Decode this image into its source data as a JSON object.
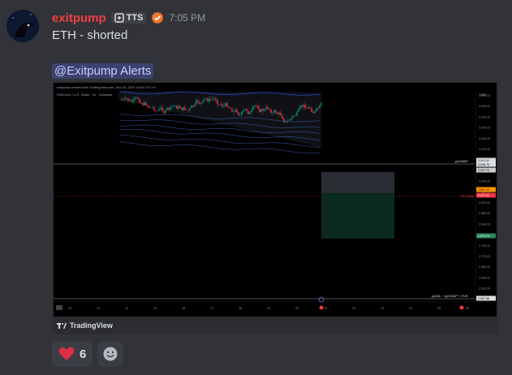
{
  "author": {
    "name": "exitpump",
    "tag": "TTS",
    "time": "7:05 PM"
  },
  "message": {
    "text": "ETH - shorted",
    "mention": "@Exitpump Alerts"
  },
  "embed": {
    "credit": "TradingView",
    "chart_header": "exitpump created with TradingView.com, Nov 20, 2025 19:05 UTC+4",
    "chart_symbol": "Ethereum / U.S. Dollar · 1h · Coinbase",
    "currency": "USD",
    "price_ticks": [
      "3,320.00",
      "3,280.00",
      "3,240.00",
      "3,200.00",
      "3,160.00",
      "3,120.00",
      "3,080.00",
      "3,040.00",
      "3,000.00",
      "2,960.00",
      "2,920.00",
      "2,880.00",
      "2,840.00",
      "2,800.00",
      "2,760.00",
      "2,720.00",
      "2,680.00",
      "2,640.00",
      "2,600.00",
      "2,560.00"
    ],
    "date_ticks": [
      "12",
      "13",
      "14",
      "15",
      "16",
      "17",
      "18",
      "19",
      "20",
      "21",
      "22",
      "23",
      "24",
      "25",
      "26"
    ],
    "labels": {
      "pyVWAP": "pyVWAP",
      "pyVAL_line": "pyVAL + pyVWAP + HVN",
      "ethusd": "ETHUSD",
      "tags": [
        "3,110.32",
        "3,096.76",
        "3,067.70",
        "2,987.44",
        "2,977.22",
        "2,870.79",
        "2,597.68"
      ]
    },
    "colors": {
      "accent": "#f23645",
      "buy": "#089981",
      "vwap": "#2962ff"
    }
  },
  "reactions": [
    {
      "emoji": "heart",
      "count": "6"
    }
  ]
}
